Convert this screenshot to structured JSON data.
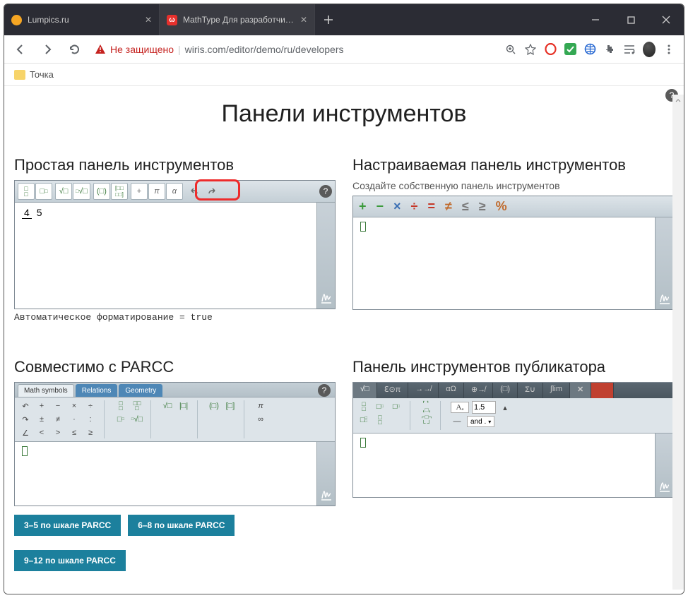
{
  "browser": {
    "tabs": [
      {
        "title": "Lumpics.ru",
        "active": false
      },
      {
        "title": "MathType Для разработчиков (",
        "active": true
      }
    ],
    "security_label": "Не защищено",
    "url": "wiris.com/editor/demo/ru/developers",
    "bookmark": "Точка"
  },
  "page": {
    "title": "Панели инструментов",
    "panels": {
      "simple": {
        "heading": "Простая панель инструментов",
        "caption": "Автоматическое форматирование = true",
        "fraction": {
          "num": "4",
          "den": "5"
        }
      },
      "custom": {
        "heading": "Настраиваемая панель инструментов",
        "subtitle": "Создайте собственную панель инструментов",
        "ops": [
          {
            "sym": "+",
            "color": "#3b9a3b"
          },
          {
            "sym": "−",
            "color": "#3b9a3b"
          },
          {
            "sym": "×",
            "color": "#3a6fb4"
          },
          {
            "sym": "÷",
            "color": "#c53828"
          },
          {
            "sym": "=",
            "color": "#c53828"
          },
          {
            "sym": "≠",
            "color": "#c06a2c"
          },
          {
            "sym": "≤",
            "color": "#7a7a7a"
          },
          {
            "sym": "≥",
            "color": "#7a7a7a"
          },
          {
            "sym": "%",
            "color": "#c06a2c"
          }
        ]
      },
      "parcc": {
        "heading": "Совместимо с PARCC",
        "tabs": [
          "Math symbols",
          "Relations",
          "Geometry"
        ],
        "buttons": [
          "3–5 по шкале PARCC",
          "6–8 по шкале PARCC",
          "9–12 по шкале PARCC"
        ]
      },
      "publisher": {
        "heading": "Панель инструментов публикатора",
        "tabs": [
          "√□",
          "ℇ⊙π",
          "→↛",
          "αΩ",
          "⊕↛",
          "(□)",
          "Σ∪",
          "∫lim",
          "✕",
          ""
        ],
        "size_value": "1.5",
        "and_label": "and ."
      }
    }
  }
}
